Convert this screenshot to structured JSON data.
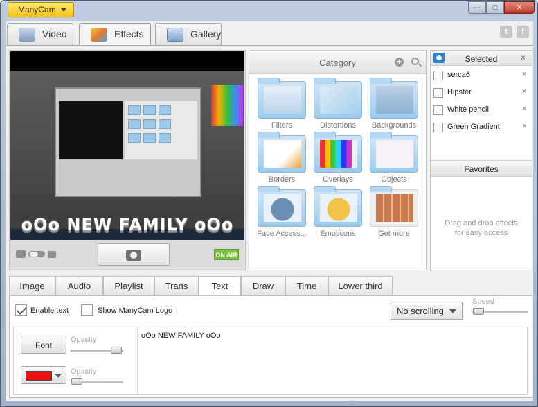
{
  "app": {
    "menu_label": "ManyCam"
  },
  "window_controls": {
    "minimize": "—",
    "maximize": "□",
    "close": "✕"
  },
  "main_tabs": [
    {
      "label": "Video",
      "icon": "video-tab-icon",
      "active": false
    },
    {
      "label": "Effects",
      "icon": "effects-tab-icon",
      "active": true
    },
    {
      "label": "Gallery",
      "icon": "gallery-tab-icon",
      "active": false
    }
  ],
  "social": {
    "twitter": "t",
    "facebook": "f"
  },
  "preview": {
    "overlay_text": "oOo NEW FAMILY oOo",
    "on_air": "ON AIR"
  },
  "category": {
    "title": "Category",
    "plus": "+",
    "items": [
      {
        "label": "Filters"
      },
      {
        "label": "Distortions"
      },
      {
        "label": "Backgrounds"
      },
      {
        "label": "Borders"
      },
      {
        "label": "Overlays"
      },
      {
        "label": "Objects"
      },
      {
        "label": "Face Access..."
      },
      {
        "label": "Emoticons"
      },
      {
        "label": "Get more"
      }
    ]
  },
  "selected": {
    "title": "Selected",
    "close": "×",
    "items": [
      {
        "label": "serca6",
        "remove": "×"
      },
      {
        "label": "Hipster",
        "remove": "×"
      },
      {
        "label": "White pencil",
        "remove": "×"
      },
      {
        "label": "Green Gradient",
        "remove": "×"
      }
    ],
    "favorites_title": "Favorites",
    "favorites_hint_line1": "Drag and drop effects",
    "favorites_hint_line2": "for easy access"
  },
  "sub_tabs": [
    {
      "label": "Image"
    },
    {
      "label": "Audio"
    },
    {
      "label": "Playlist"
    },
    {
      "label": "Trans"
    },
    {
      "label": "Text",
      "active": true
    },
    {
      "label": "Draw"
    },
    {
      "label": "Time"
    },
    {
      "label": "Lower third"
    }
  ],
  "text_panel": {
    "enable_text_label": "Enable text",
    "enable_text_checked": true,
    "show_logo_label": "Show ManyCam Logo",
    "show_logo_checked": false,
    "scrolling_value": "No scrolling",
    "speed_label": "Speed",
    "font_button": "Font",
    "opacity_label_1": "Opacity",
    "opacity_label_2": "Opacity",
    "text_value": "oOo NEW FAMILY oOo",
    "text_color": "#ee1111"
  }
}
